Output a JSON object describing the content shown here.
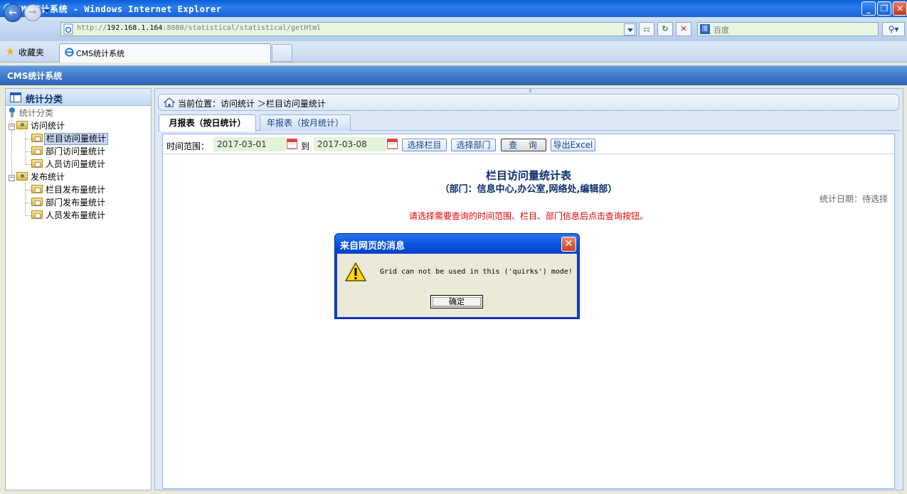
{
  "browser": {
    "window_title": "CMS统计系统 - Windows Internet Explorer",
    "address_url": "http://192.168.1.164:8080/statistical/statistical/getHtml",
    "address_host": "192.168.1.164",
    "address_prefix": "http://",
    "address_suffix": ":8080/statistical/statistical/getHtml",
    "search_placeholder": "百度",
    "favorites_label": "收藏夹",
    "tab_title": "CMS统计系统",
    "title_bar_color": "#1d62d6"
  },
  "app": {
    "header_title": "CMS统计系统",
    "header_color": "#3a76c4"
  },
  "sidebar": {
    "panel_title": "统计分类",
    "tree": [
      {
        "label": "统计分类",
        "type": "root"
      },
      {
        "label": "访问统计",
        "type": "group"
      },
      {
        "label": "栏目访问量统计",
        "type": "leaf",
        "selected": true
      },
      {
        "label": "部门访问量统计",
        "type": "leaf"
      },
      {
        "label": "人员访问量统计",
        "type": "leaf"
      },
      {
        "label": "发布统计",
        "type": "group"
      },
      {
        "label": "栏目发布量统计",
        "type": "leaf"
      },
      {
        "label": "部门发布量统计",
        "type": "leaf"
      },
      {
        "label": "人员发布量统计",
        "type": "leaf"
      }
    ]
  },
  "main": {
    "breadcrumb": "当前位置：访问统计 ＞栏目访问量统计",
    "tabs": [
      {
        "label": "月报表（按日统计）",
        "active": true
      },
      {
        "label": "年报表（按月统计）",
        "active": false
      }
    ],
    "toolbar": {
      "range_label": "时间范围：",
      "start_date": "2017-03-01",
      "to_label": "到",
      "end_date": "2017-03-08",
      "select_column_button": "选择栏目",
      "select_dept_button": "选择部门",
      "query_button": "查 询",
      "export_button": "导出Excel"
    },
    "report": {
      "title": "栏目访问量统计表",
      "subtitle": "（部门：信息中心,办公室,网络处,编辑部）",
      "stat_date": "统计日期：待选择",
      "hint": "请选择需要查询的时间范围、栏目、部门信息后点击查询按钮。",
      "hint_color": "#e00000"
    }
  },
  "dialog": {
    "title": "来自网页的消息",
    "message": "Grid can not be used in this ('quirks') mode!",
    "ok_button": "确定",
    "icon": "warning-icon"
  }
}
